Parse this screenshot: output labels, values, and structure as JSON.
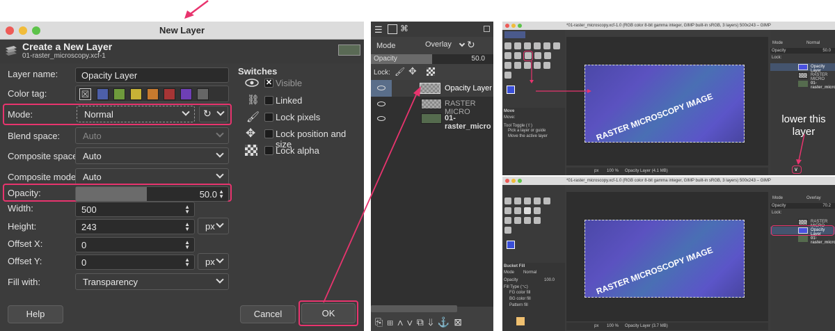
{
  "dialog": {
    "window_title": "New Layer",
    "header_title": "Create a New Layer",
    "header_subtitle": "01-raster_microscopy.xcf-1",
    "fields": {
      "layer_name_label": "Layer name:",
      "layer_name_value": "Opacity Layer",
      "color_tag_label": "Color tag:",
      "mode_label": "Mode:",
      "mode_value": "Normal",
      "blend_space_label": "Blend space:",
      "blend_space_value": "Auto",
      "composite_space_label": "Composite space:",
      "composite_space_value": "Auto",
      "composite_mode_label": "Composite mode:",
      "composite_mode_value": "Auto",
      "opacity_label": "Opacity:",
      "opacity_value": "50.0",
      "width_label": "Width:",
      "width_value": "500",
      "height_label": "Height:",
      "height_value": "243",
      "unit": "px",
      "offset_x_label": "Offset X:",
      "offset_x_value": "0",
      "offset_y_label": "Offset Y:",
      "offset_y_value": "0",
      "fill_label": "Fill with:",
      "fill_value": "Transparency"
    },
    "color_tags": [
      "#4d5fa8",
      "#6f9a3c",
      "#c8b236",
      "#c77a2e",
      "#a63535",
      "#6e3fb5",
      "#666666"
    ],
    "switches": {
      "title": "Switches",
      "visible": "Visible",
      "linked": "Linked",
      "lock_pixels": "Lock pixels",
      "lock_position": "Lock position and size",
      "lock_alpha": "Lock alpha"
    },
    "buttons": {
      "help": "Help",
      "cancel": "Cancel",
      "ok": "OK"
    }
  },
  "layers_panel": {
    "mode_label": "Mode",
    "mode_value": "Overlay",
    "opacity_label": "Opacity",
    "opacity_value": "50.0",
    "lock_label": "Lock:",
    "layers": [
      "Opacity Layer",
      "RASTER MICRO",
      "01-raster_micro"
    ]
  },
  "gimp_top": {
    "title": "*01-raster_microscopy.xcf-1.0 (RGB color 8-bit gamma integer, GIMP built-in sRGB, 3 layers) 500x243 – GIMP",
    "image_text": "RASTER MICROSCOPY IMAGE",
    "status_zoom": "100 %",
    "status_text": "Opacity Layer (4.1 MB)",
    "status_unit": "px",
    "tool_name": "Move",
    "tool_options": [
      "Move:",
      "Tool Toggle (⇧)",
      "Pick a layer or guide",
      "Move the active layer"
    ],
    "layers": [
      "Opacity Layer",
      "RASTER MICRO",
      "01-raster_micro"
    ],
    "mode_label": "Mode",
    "mode_value": "Normal",
    "opacity_label": "Opacity",
    "opacity_value": "50.0",
    "lock_label": "Lock:",
    "annotation": "lower this layer"
  },
  "gimp_bottom": {
    "title": "*01-raster_microscopy.xcf-1.0 (RGB color 8-bit gamma integer, GIMP built-in sRGB, 3 layers) 500x243 – GIMP",
    "image_text": "RASTER MICROSCOPY IMAGE",
    "status_zoom": "100 %",
    "status_text": "Opacity Layer (3.7 MB)",
    "status_unit": "px",
    "tool_name": "Bucket Fill",
    "tool_options": [
      "Mode",
      "Normal",
      "Opacity",
      "100.0",
      "Fill Type (⌥)",
      "FG color fill",
      "BG color fill",
      "Pattern fill"
    ],
    "layers": [
      "RASTER MICRO",
      "Opacity Layer",
      "01-raster_micro"
    ],
    "mode_label": "Mode",
    "mode_value": "Overlay",
    "opacity_label": "Opacity",
    "opacity_value": "70.2",
    "lock_label": "Lock:"
  },
  "colors": {
    "highlight": "#e8346e",
    "image_blue": "#5552c0",
    "dark_bg": "#3c3c3c"
  }
}
